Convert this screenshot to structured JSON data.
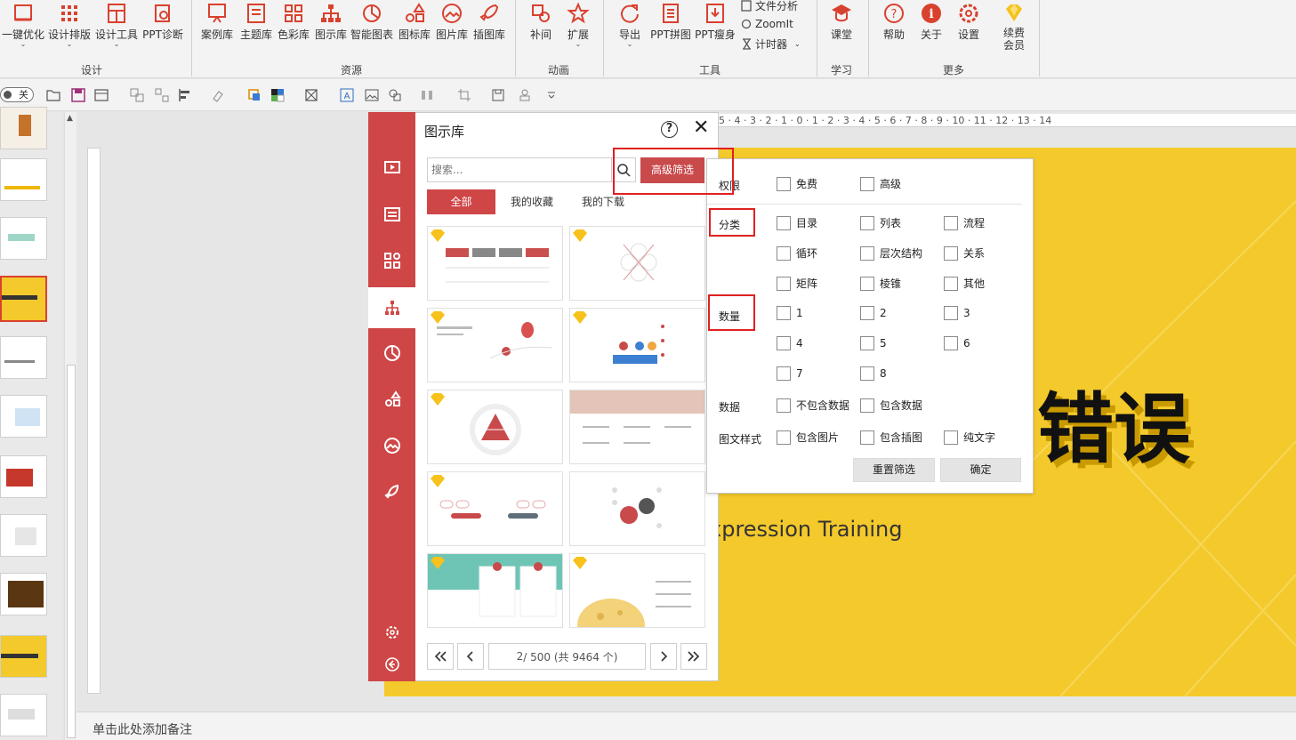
{
  "ribbon": {
    "groups": [
      {
        "label": "设计"
      },
      {
        "label": "资源"
      },
      {
        "label": "动画"
      },
      {
        "label": "工具"
      },
      {
        "label": "学习"
      },
      {
        "label": "更多"
      }
    ],
    "buttons": [
      {
        "label": "一键优化",
        "icon": "magic-icon"
      },
      {
        "label": "设计排版",
        "icon": "grid-icon"
      },
      {
        "label": "设计工具",
        "icon": "layout-icon"
      },
      {
        "label": "PPT诊断",
        "icon": "diagnose-icon"
      },
      {
        "label": "案例库",
        "icon": "case-icon"
      },
      {
        "label": "主题库",
        "icon": "theme-icon"
      },
      {
        "label": "色彩库",
        "icon": "palette-icon"
      },
      {
        "label": "图示库",
        "icon": "org-chart-icon"
      },
      {
        "label": "智能图表",
        "icon": "pie-icon"
      },
      {
        "label": "图标库",
        "icon": "shapes-icon"
      },
      {
        "label": "图片库",
        "icon": "image-icon"
      },
      {
        "label": "插图库",
        "icon": "rocket-icon"
      },
      {
        "label": "补间",
        "icon": "tween-icon"
      },
      {
        "label": "扩展",
        "icon": "star-icon"
      },
      {
        "label": "导出",
        "icon": "export-icon"
      },
      {
        "label": "PPT拼图",
        "icon": "puzzle-icon"
      },
      {
        "label": "PPT瘦身",
        "icon": "slim-icon"
      },
      {
        "label": "课堂",
        "icon": "classroom-icon"
      },
      {
        "label": "帮助",
        "icon": "help-icon"
      },
      {
        "label": "关于",
        "icon": "info-icon"
      },
      {
        "label": "设置",
        "icon": "settings-icon"
      },
      {
        "label": "续费\n会员",
        "icon": "vip-icon"
      }
    ],
    "small_tools": {
      "file_analysis": "文件分析",
      "zoomit": "ZoomIt",
      "timer": "计时器"
    }
  },
  "quick_toolbar": {
    "toggle_label": "关"
  },
  "slide": {
    "title": "错误",
    "subtitle": "xpression Training",
    "notes_placeholder": "单击此处添加备注"
  },
  "ruler": {
    "h_ticks": "5 · 4 · 3 · 2 · 1 · 0 · 1 · 2 · 3 · 4 · 5 · 6 · 7 · 8 · 9 · 10 · 11 · 12 · 13 · 14"
  },
  "gallery": {
    "title": "图示库",
    "help": "?",
    "close": "✕",
    "search_placeholder": "搜索...",
    "advanced_filter": "高级筛选",
    "tabs": [
      "全部",
      "我的收藏",
      "我的下载"
    ],
    "pager": {
      "current": "2",
      "total_text": " / 500 (共 9464 个)"
    }
  },
  "filter": {
    "permission": {
      "label": "权限",
      "options": [
        "免费",
        "高级"
      ]
    },
    "category": {
      "label": "分类",
      "options": [
        "目录",
        "列表",
        "流程",
        "循环",
        "层次结构",
        "关系",
        "矩阵",
        "棱锥",
        "其他"
      ]
    },
    "count": {
      "label": "数量",
      "options": [
        "1",
        "2",
        "3",
        "4",
        "5",
        "6",
        "7",
        "8"
      ]
    },
    "data": {
      "label": "数据",
      "options": [
        "不包含数据",
        "包含数据"
      ]
    },
    "style": {
      "label": "图文样式",
      "options": [
        "包含图片",
        "包含插图",
        "纯文字"
      ]
    },
    "reset": "重置筛选",
    "confirm": "确定"
  },
  "colors": {
    "accent": "#cf4647",
    "slide_bg": "#f4c92b",
    "highlight": "#e02020"
  }
}
